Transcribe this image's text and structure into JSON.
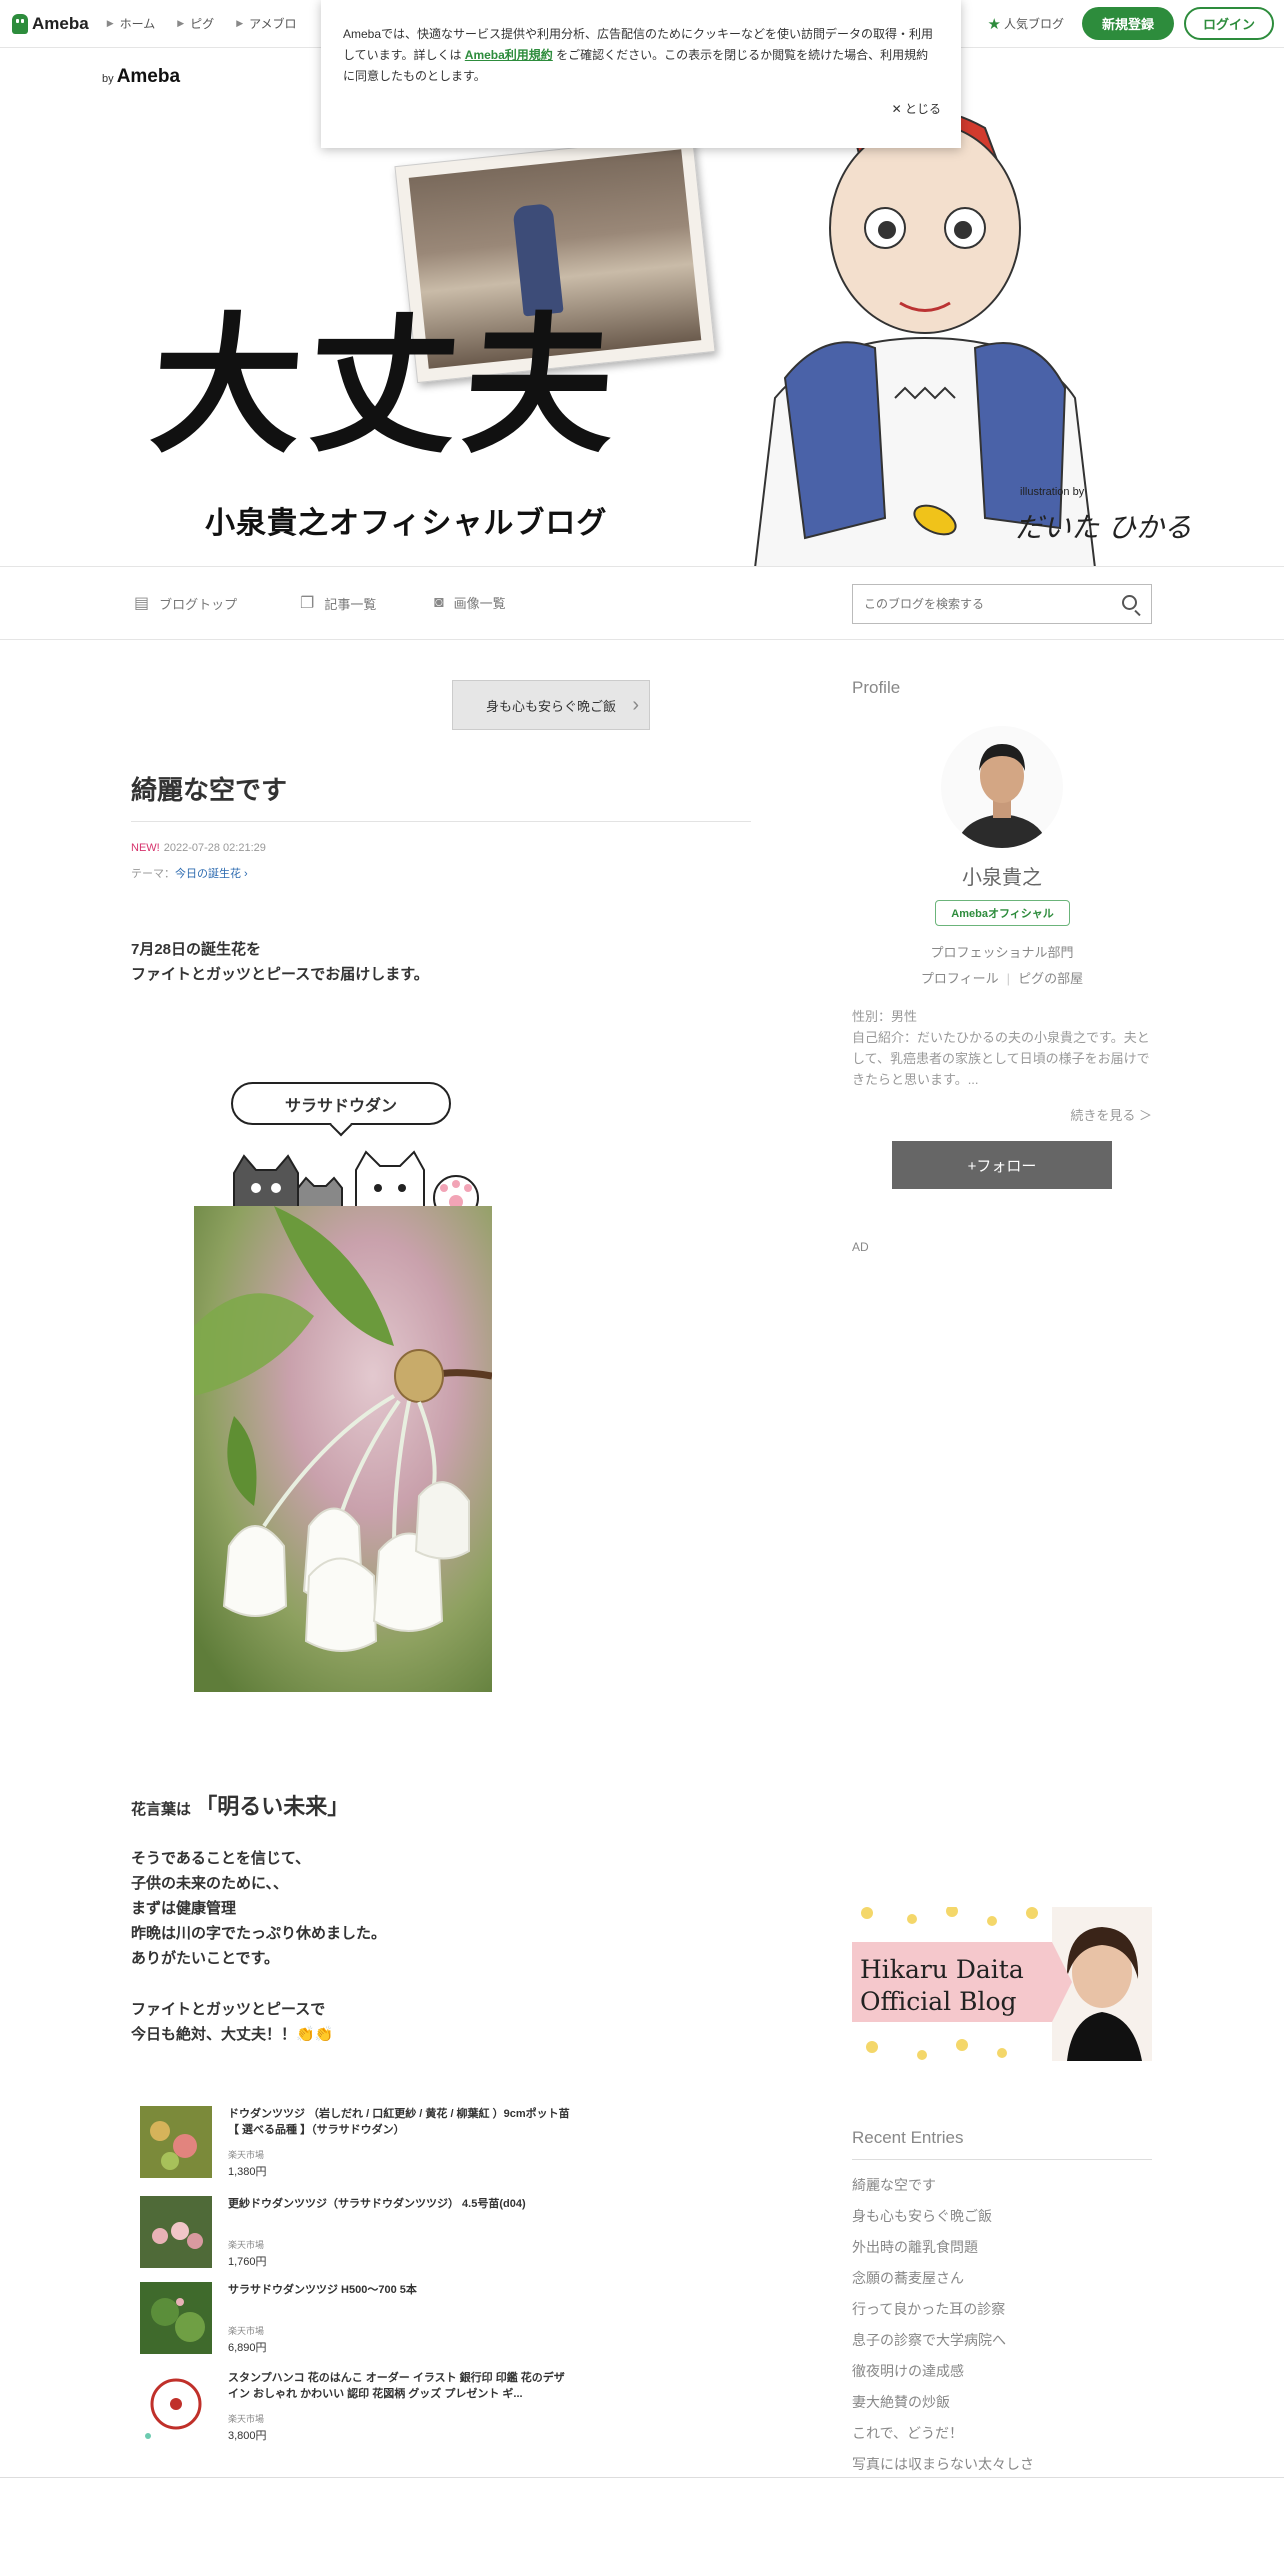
{
  "topbar": {
    "logo": "Ameba",
    "nav": [
      "ホーム",
      "ピグ",
      "アメブロ"
    ],
    "popular": "人気ブログ",
    "signup": "新規登録",
    "login": "ログイン"
  },
  "cookie": {
    "text_before": "Amebaでは、快適なサービス提供や利用分析、広告配信のためにクッキーなどを使い訪問データの取得・利用しています。詳しくは",
    "link": "Ameba利用規約",
    "text_after": "をご確認ください。この表示を閉じるか閲覧を続けた場合、利用規約に同意したものとします。",
    "close": "とじる"
  },
  "banner": {
    "by": "by",
    "by_brand": "Ameba",
    "title": "大丈夫",
    "subtitle": "小泉貴之オフィシャルブログ",
    "illus_by": "illustration by",
    "illus_sig": "だいた ひかる"
  },
  "blognav": {
    "top": "ブログトップ",
    "entries": "記事一覧",
    "images": "画像一覧",
    "search_placeholder": "このブログを検索する"
  },
  "article": {
    "prev": "身も心も安らぐ晩ご飯",
    "title": "綺麗な空です",
    "new_badge": "NEW!",
    "date": "2022-07-28 02:21:29",
    "theme_label": "テーマ：",
    "theme": "今日の誕生花",
    "p1_l1": "7月28日の誕生花を",
    "p1_l2": "ファイトとガッツとピースでお届けします。",
    "bubble": "サラサドウダン",
    "kotoba_pre": "花言葉は",
    "kotoba_main": "「明るい未来」",
    "p2": [
      "そうであることを信じて、",
      "子供の未来のために、、",
      "まずは健康管理",
      "昨晩は川の字でたっぷり休めました。",
      "ありがたいことです。"
    ],
    "p3": [
      "ファイトとガッツとピースで",
      "今日も絶対、大丈夫！！👏👏"
    ]
  },
  "products": [
    {
      "name": "ドウダンツツジ （岩しだれ / 口紅更紗 / 黄花 / 柳葉紅 ）9cmポット苗【 選べる品種 】（サラサドウダン）",
      "shop": "楽天市場",
      "price": "1,380円"
    },
    {
      "name": "更紗ドウダンツツジ（サラサドウダンツツジ） 4.5号苗(d04)",
      "shop": "楽天市場",
      "price": "1,760円"
    },
    {
      "name": "サラサドウダンツツジ H500〜700 5本",
      "shop": "楽天市場",
      "price": "6,890円"
    },
    {
      "name": "スタンプハンコ 花のはんこ オーダー イラスト 銀行印 印鑑 花のデザイン おしゃれ かわいい 認印 花図柄 グッズ プレゼント ギ...",
      "shop": "楽天市場",
      "price": "3,800円"
    }
  ],
  "sidebar": {
    "profile_h": "Profile",
    "name": "小泉貴之",
    "official": "Amebaオフィシャル",
    "dept": "プロフェッショナル部門",
    "link_profile": "プロフィール",
    "link_pig": "ピグの部屋",
    "gender": "性別：男性",
    "intro": "自己紹介：だいたひかるの夫の小泉貴之です。夫として、乳癌患者の家族として日頃の様子をお届けできたらと思います。...",
    "more": "続きを見る ＞",
    "follow": "+フォロー",
    "ad": "AD",
    "hikaru_l1": "Hikaru Daita",
    "hikaru_l2": "Official Blog",
    "recent_h": "Recent Entries",
    "recent": [
      "綺麗な空です",
      "身も心も安らぐ晩ご飯",
      "外出時の離乳食問題",
      "念願の蕎麦屋さん",
      "行って良かった耳の診察",
      "息子の診察で大学病院へ",
      "徹夜明けの達成感",
      "妻大絶賛の炒飯",
      "これで、どうだ！",
      "写真には収まらない太々しさ"
    ]
  },
  "colors": {
    "brand": "#2d8c3c",
    "new": "#d6336c",
    "link": "#2d6bb0"
  }
}
